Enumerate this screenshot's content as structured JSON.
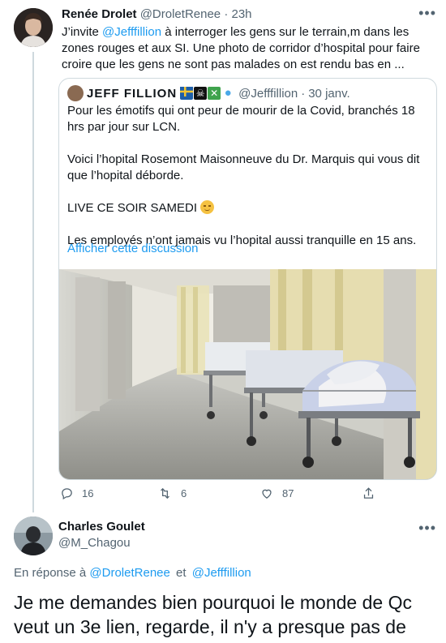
{
  "tweet1": {
    "name": "Renée Drolet",
    "handle": "@DroletRenee",
    "sep": "·",
    "time": "23h",
    "text_pre": "J’invite ",
    "text_mention": "@Jefffillion",
    "text_post": " à interroger les gens sur le terrain,m dans les zones rouges et aux SI. Une photo de corridor d’hospital pour faire croire que les gens ne sont pas malades on est rendu bas en ...",
    "actions": {
      "reply_count": "16",
      "retweet_count": "6",
      "like_count": "87"
    }
  },
  "quote": {
    "name": "JEFF FILLION",
    "handle": "@Jefffillion",
    "sep": "·",
    "date": "30 janv.",
    "paragraphs": [
      "Pour les émotifs qui ont peur de mourir de la Covid, branchés 18 hrs par jour sur LCN.",
      "Voici l’hopital Rosemont Maisonneuve du Dr. Marquis qui vous dit que l’hopital déborde.",
      "LIVE CE SOIR  SAMEDI",
      "Les employés n’ont jamais vu l’hopital aussi tranquille en 15 ans."
    ],
    "link": "Afficher cette discussion"
  },
  "tweet2": {
    "name": "Charles Goulet",
    "handle": "@M_Chagou",
    "reply_prefix": "En réponse à",
    "reply_user1": "@DroletRenee",
    "reply_and": "et",
    "reply_user2": "@Jefffillion",
    "text": "Je me demandes bien pourquoi le monde de Qc veut un 3e lien, regarde, il n'y a presque pas de circulation."
  },
  "colors": {
    "accent": "#1d9bf0",
    "text": "#0f1419",
    "muted": "#536471",
    "border": "#cfd9de"
  }
}
